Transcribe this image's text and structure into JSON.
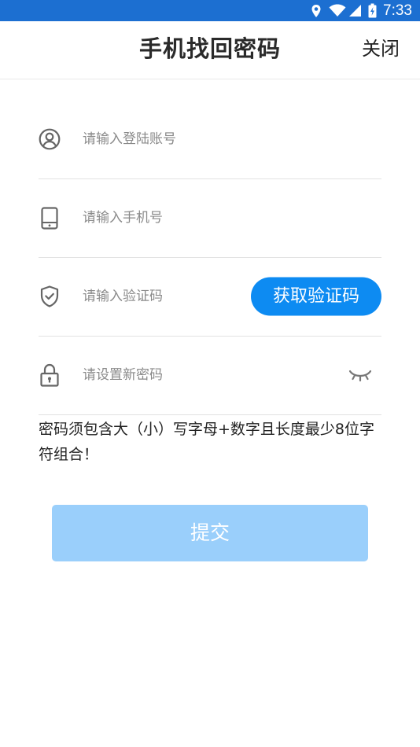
{
  "status_bar": {
    "time": "7:33",
    "icons": [
      "location-icon",
      "wifi-icon",
      "signal-icon",
      "battery-icon"
    ]
  },
  "header": {
    "title": "手机找回密码",
    "close_label": "关闭"
  },
  "form": {
    "account": {
      "placeholder": "请输入登陆账号",
      "value": "",
      "icon": "user-icon"
    },
    "phone": {
      "placeholder": "请输入手机号",
      "value": "",
      "icon": "phone-icon"
    },
    "code": {
      "placeholder": "请输入验证码",
      "value": "",
      "icon": "shield-icon",
      "button_label": "获取验证码"
    },
    "password": {
      "placeholder": "请设置新密码",
      "value": "",
      "icon": "lock-icon",
      "toggle_icon": "eye-closed-icon"
    }
  },
  "hint": " 密码须包含大（小）写字母+数字且长度最少8位字符组合！",
  "submit_label": "提交",
  "colors": {
    "status_bar": "#1c6fd1",
    "primary": "#0d8bf2",
    "submit_disabled": "#9acffb",
    "icon_gray": "#666666"
  }
}
